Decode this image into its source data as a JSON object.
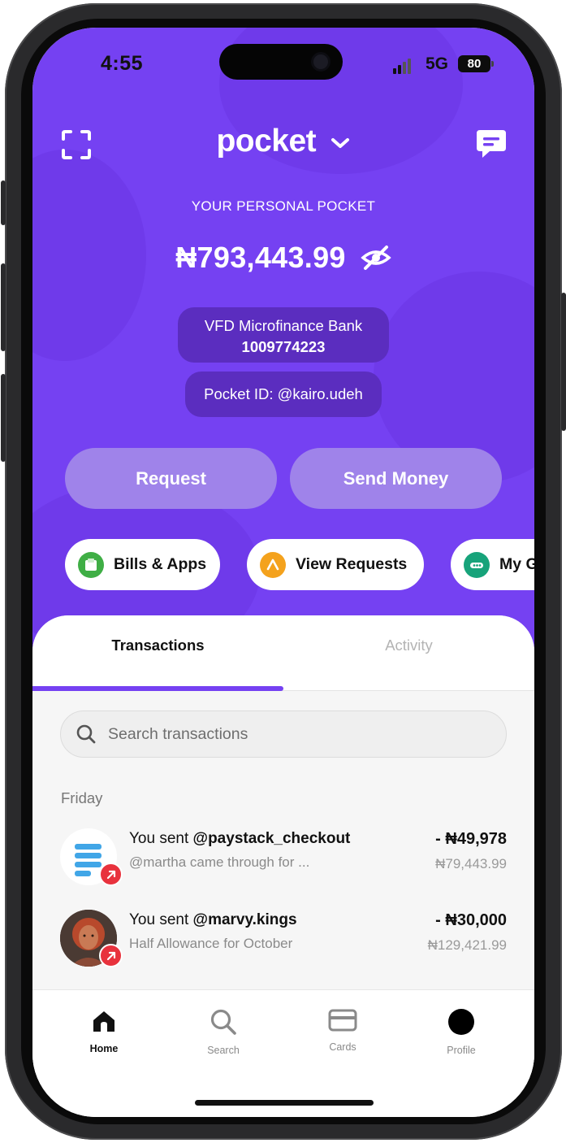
{
  "status": {
    "time": "4:55",
    "network": "5G",
    "battery": "80"
  },
  "header": {
    "brand": "pocket",
    "scan_icon": "scan-icon",
    "chat_icon": "chat-icon"
  },
  "wallet": {
    "label": "YOUR PERSONAL POCKET",
    "balance": "₦793,443.99",
    "bank_name": "VFD Microfinance Bank",
    "account_number": "1009774223",
    "pocket_id": "Pocket ID: @kairo.udeh"
  },
  "actions": {
    "request": "Request",
    "send_money": "Send Money"
  },
  "quick": [
    {
      "label": "Bills & Apps",
      "icon": "bills-icon",
      "color": "#3fae45"
    },
    {
      "label": "View Requests",
      "icon": "requests-icon",
      "color": "#f4a21d"
    },
    {
      "label": "My G",
      "icon": "goals-icon",
      "color": "#17a37a"
    }
  ],
  "tabs": {
    "transactions": "Transactions",
    "activity": "Activity"
  },
  "search": {
    "placeholder": "Search transactions"
  },
  "section": {
    "day": "Friday"
  },
  "transactions": [
    {
      "prefix": "You sent ",
      "user": "@paystack_checkout",
      "note": "@martha came through for ...",
      "amount": "- ₦49,978",
      "balance": "₦79,443.99"
    },
    {
      "prefix": "You sent ",
      "user": "@marvy.kings",
      "note": "Half Allowance for October",
      "amount": "- ₦30,000",
      "balance": "₦129,421.99"
    }
  ],
  "nav": {
    "home": "Home",
    "search": "Search",
    "cards": "Cards",
    "profile": "Profile"
  },
  "colors": {
    "brand": "#7541f2",
    "debit_badge": "#e8323d"
  }
}
